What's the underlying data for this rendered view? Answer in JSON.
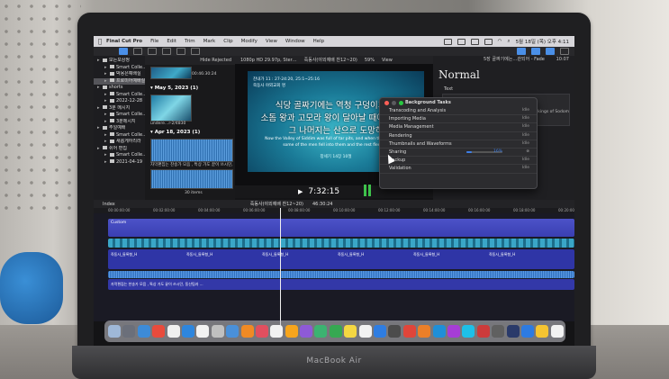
{
  "menubar": {
    "app_name": "Final Cut Pro",
    "items": [
      "File",
      "Edit",
      "Trim",
      "Mark",
      "Clip",
      "Modify",
      "View",
      "Window",
      "Help"
    ],
    "clock": "5월 18일 (목) 오후 4:11"
  },
  "browser": {
    "sidebar": [
      {
        "label": "모든보상정",
        "level": 0,
        "selected": false
      },
      {
        "label": "Smart Colle…",
        "level": 1,
        "selected": false
      },
      {
        "label": "박용은예배실",
        "level": 1,
        "selected": false
      },
      {
        "label": "프로미어예배실",
        "level": 1,
        "selected": true
      },
      {
        "label": "shorts",
        "level": 0,
        "selected": false
      },
      {
        "label": "Smart Colle…",
        "level": 1,
        "selected": false
      },
      {
        "label": "2022-12-28",
        "level": 1,
        "selected": false
      },
      {
        "label": "3분 메시지",
        "level": 0,
        "selected": false
      },
      {
        "label": "Smart Colle…",
        "level": 1,
        "selected": false
      },
      {
        "label": "3분메시지",
        "level": 1,
        "selected": false
      },
      {
        "label": "주일예배",
        "level": 0,
        "selected": false
      },
      {
        "label": "Smart Colle…",
        "level": 1,
        "selected": false
      },
      {
        "label": "새롭게하리라",
        "level": 1,
        "selected": false
      },
      {
        "label": "쉬어 편집",
        "level": 0,
        "selected": false
      },
      {
        "label": "Smart Colle…",
        "level": 1,
        "selected": false
      },
      {
        "label": "2021-04-19",
        "level": 1,
        "selected": false
      }
    ],
    "filter": "Hide Rejected",
    "first_clip_duration": "00:46:30:24",
    "groups": [
      {
        "date": "May 5, 2023",
        "count": "(1)",
        "clip_caption": "undere…r-2/4830"
      },
      {
        "date": "Apr 18, 2023",
        "count": "(1)",
        "clip_caption": "자막편집는 찬송가 모음 , 특상 가도 끝이 쓰시던, 동산팀과 …"
      }
    ],
    "items_count": "30 items"
  },
  "viewer": {
    "format": "1080p HD 29.97p, Ster…",
    "project": "죽동사(야외예배 찬12~20)",
    "zoom": "59%",
    "view": "View",
    "frame_line1": "찬내가 11 : 27-24:20, 25:1~25:16",
    "frame_line2": "죽동사 야외교회 명",
    "frame_big1": "식당 골짜기에는 역청 구덩이가 많",
    "frame_big2": "소돔 왕과 고모라 왕이 달아날 때에 그들이",
    "frame_big3": "그 나머지는 산으로 도망하",
    "frame_en1": "Now the Valley of Siddim was full of tar pits, and when the kings of So",
    "frame_en2": "some of the men fell into them and the rest fled to t",
    "frame_sign": "창세기 14장 10절",
    "timecode": "7:32:15"
  },
  "inspector": {
    "header": "5장 골짜기에는…관되어 - Fade",
    "duration": "10:07",
    "style_name": "Normal",
    "section_label": "Text",
    "text_snippet": "e kings of Sodom"
  },
  "background_tasks": {
    "title": "Background Tasks",
    "tasks": [
      {
        "name": "Transcoding and Analysis",
        "status": "Idle"
      },
      {
        "name": "Importing Media",
        "status": "Idle"
      },
      {
        "name": "Media Management",
        "status": "Idle"
      },
      {
        "name": "Rendering",
        "status": "Idle"
      },
      {
        "name": "Thumbnails and Waveforms",
        "status": "Idle"
      },
      {
        "name": "Sharing",
        "status": "",
        "progress": 0.16,
        "progress_text": "16%"
      },
      {
        "name": "Backup",
        "status": "Idle"
      },
      {
        "name": "Validation",
        "status": "Idle"
      }
    ]
  },
  "timeline": {
    "index_label": "Index",
    "project": "죽동사(야외예배 찬12~20)",
    "project_duration": "46:30:24",
    "ruler": [
      "00:00:00:00",
      "00:02:00:00",
      "00:04:00:00",
      "00:06:00:00",
      "00:08:00:00",
      "00:10:00:00",
      "00:12:00:00",
      "00:14:00:00",
      "00:16:00:00",
      "00:18:00:00",
      "00:20:00:00"
    ],
    "track_custom_label": "Custom",
    "clip_labels": [
      "죽동사_들록형_H",
      "죽동사_들록형_H",
      "죽동사_들록형_H",
      "죽동사_들록형_H",
      "죽동사_들록형_H",
      "죽동사_들록형_H"
    ],
    "audio_label": "자막편집는 찬송가 모음 , 특상 가도 끝이 쓰시던, 동산팀과 …"
  },
  "laptop_brand": "MacBook Air",
  "dock_colors": [
    "#9fb8d8",
    "#6b6f7a",
    "#3d8bd8",
    "#e84b3c",
    "#f0f0f0",
    "#2e86de",
    "#f2f2f2",
    "#c0c0c0",
    "#4a90d9",
    "#f08a24",
    "#e04f5f",
    "#f2f2f2",
    "#f7a51c",
    "#8e5ad7",
    "#3cb371",
    "#36a852",
    "#f5d742",
    "#f2f2f2",
    "#2f7de1",
    "#4c4c4c",
    "#e0453a",
    "#ec7f28",
    "#1f8fd8",
    "#a63dd6",
    "#1ec0e8",
    "#cc3b3b",
    "#606060",
    "#2a3a6a",
    "#2d7be2",
    "#f5c431",
    "#f2f2f2"
  ]
}
